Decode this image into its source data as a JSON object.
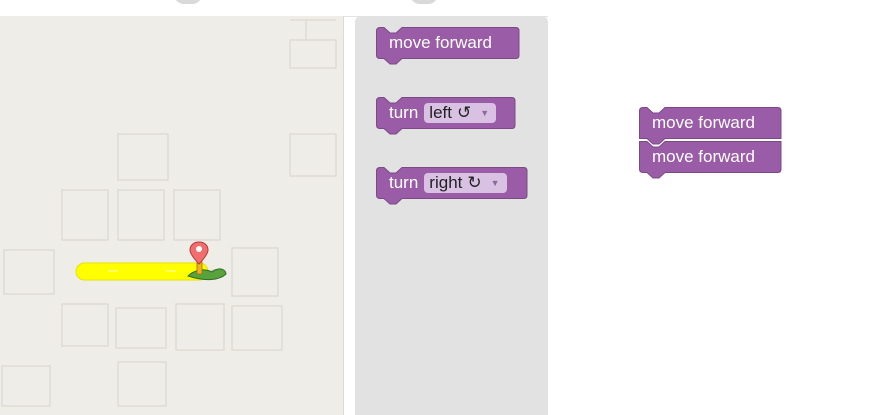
{
  "maze": {
    "path_color": "#ffff00",
    "start_icon": "pegman",
    "goal_icon": "map-marker"
  },
  "toolbox": {
    "blocks": [
      {
        "label": "move forward"
      },
      {
        "label": "turn",
        "dropdown": "left",
        "rotate_glyph": "↺"
      },
      {
        "label": "turn",
        "dropdown": "right",
        "rotate_glyph": "↻"
      }
    ]
  },
  "workspace": {
    "stack": [
      {
        "label": "move forward"
      },
      {
        "label": "move forward"
      }
    ]
  },
  "colors": {
    "block_fill": "#9a5ca6",
    "block_border": "#7b4a85",
    "dropdown_bg": "#d9c1e3",
    "toolbox_bg": "#e2e2e3",
    "maze_bg": "#efede8"
  }
}
